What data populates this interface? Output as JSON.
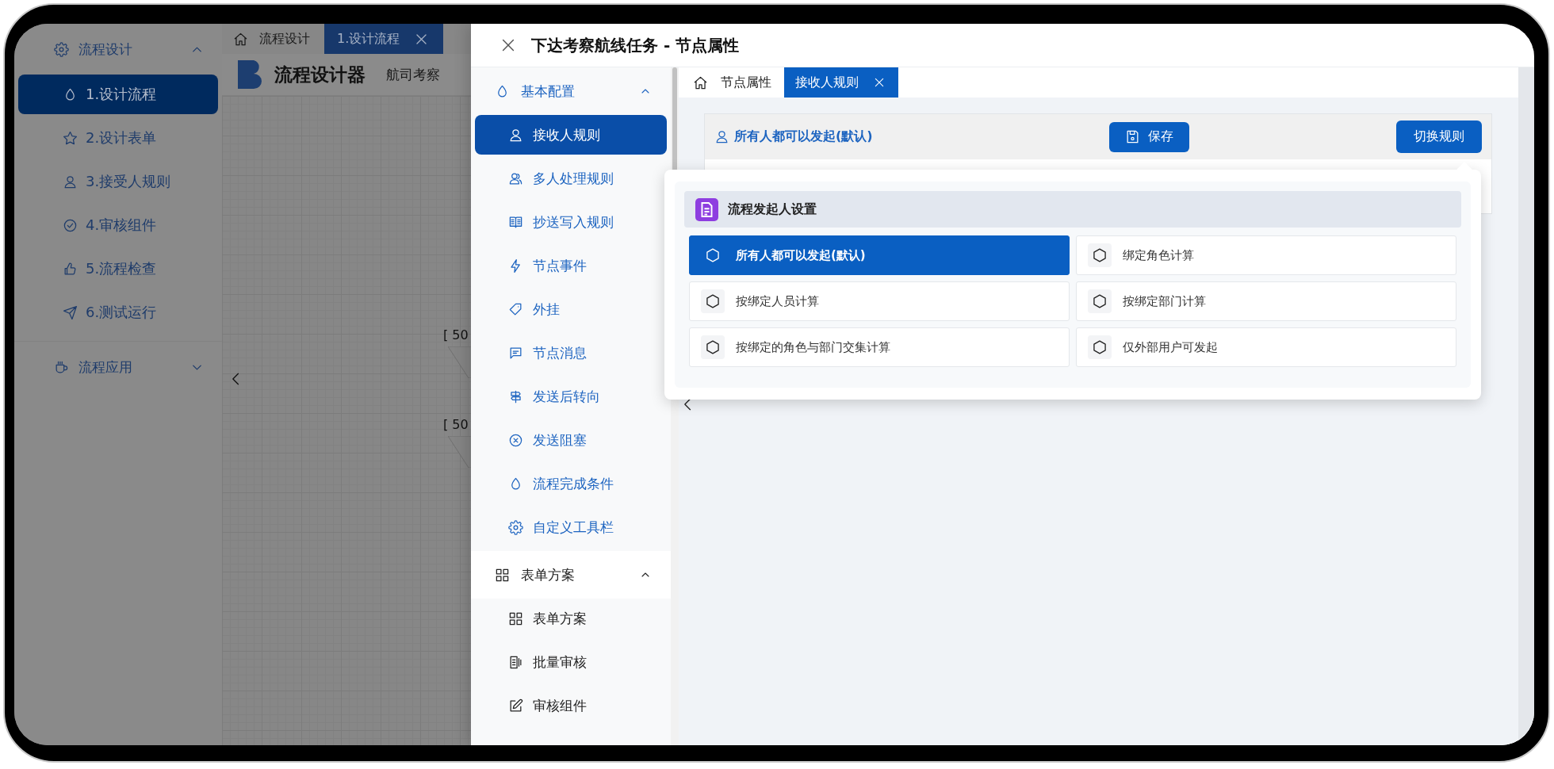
{
  "sidebar": {
    "groups": [
      {
        "label": "流程设计",
        "expanded": true,
        "items": [
          {
            "label": "1.设计流程",
            "selected": true
          },
          {
            "label": "2.设计表单",
            "selected": false
          },
          {
            "label": "3.接受人规则",
            "selected": false
          },
          {
            "label": "4.审核组件",
            "selected": false
          },
          {
            "label": "5.流程检查",
            "selected": false
          },
          {
            "label": "6.测试运行",
            "selected": false
          }
        ]
      },
      {
        "label": "流程应用",
        "expanded": false
      }
    ]
  },
  "top_tabs": {
    "home": "流程设计",
    "tabs": [
      {
        "label": "1.设计流程",
        "selected": true
      }
    ]
  },
  "designer": {
    "title": "流程设计器",
    "user": "航司考察"
  },
  "canvas": {
    "nodes": [
      {
        "label": "[ 50"
      },
      {
        "label": "[ 50"
      }
    ]
  },
  "drawer": {
    "title": "下达考察航线任务 - 节点属性",
    "nav": [
      {
        "label": "基本配置",
        "expanded": true,
        "active": true,
        "items": [
          {
            "label": "接收人规则",
            "selected": true
          },
          {
            "label": "多人处理规则",
            "selected": false
          },
          {
            "label": "抄送写入规则",
            "selected": false
          },
          {
            "label": "节点事件",
            "selected": false
          },
          {
            "label": "外挂",
            "selected": false
          },
          {
            "label": "节点消息",
            "selected": false
          },
          {
            "label": "发送后转向",
            "selected": false
          },
          {
            "label": "发送阻塞",
            "selected": false
          },
          {
            "label": "流程完成条件",
            "selected": false
          },
          {
            "label": "自定义工具栏",
            "selected": false
          }
        ]
      },
      {
        "label": "表单方案",
        "expanded": true,
        "active": false,
        "items": [
          {
            "label": "表单方案",
            "selected": false
          },
          {
            "label": "批量审核",
            "selected": false
          },
          {
            "label": "审核组件",
            "selected": false
          }
        ]
      }
    ],
    "tabs": {
      "home": "节点属性",
      "tabs": [
        {
          "label": "接收人规则",
          "selected": true
        }
      ]
    },
    "rule_bar": {
      "current": "所有人都可以发起(默认)",
      "save": "保存",
      "switch": "切换规则"
    },
    "rule_popup": {
      "title": "流程发起人设置",
      "options": [
        {
          "label": "所有人都可以发起(默认)",
          "selected": true
        },
        {
          "label": "绑定角色计算",
          "selected": false
        },
        {
          "label": "按绑定人员计算",
          "selected": false
        },
        {
          "label": "按绑定部门计算",
          "selected": false
        },
        {
          "label": "按绑定的角色与部门交集计算",
          "selected": false
        },
        {
          "label": "仅外部用户可发起",
          "selected": false
        }
      ]
    }
  }
}
